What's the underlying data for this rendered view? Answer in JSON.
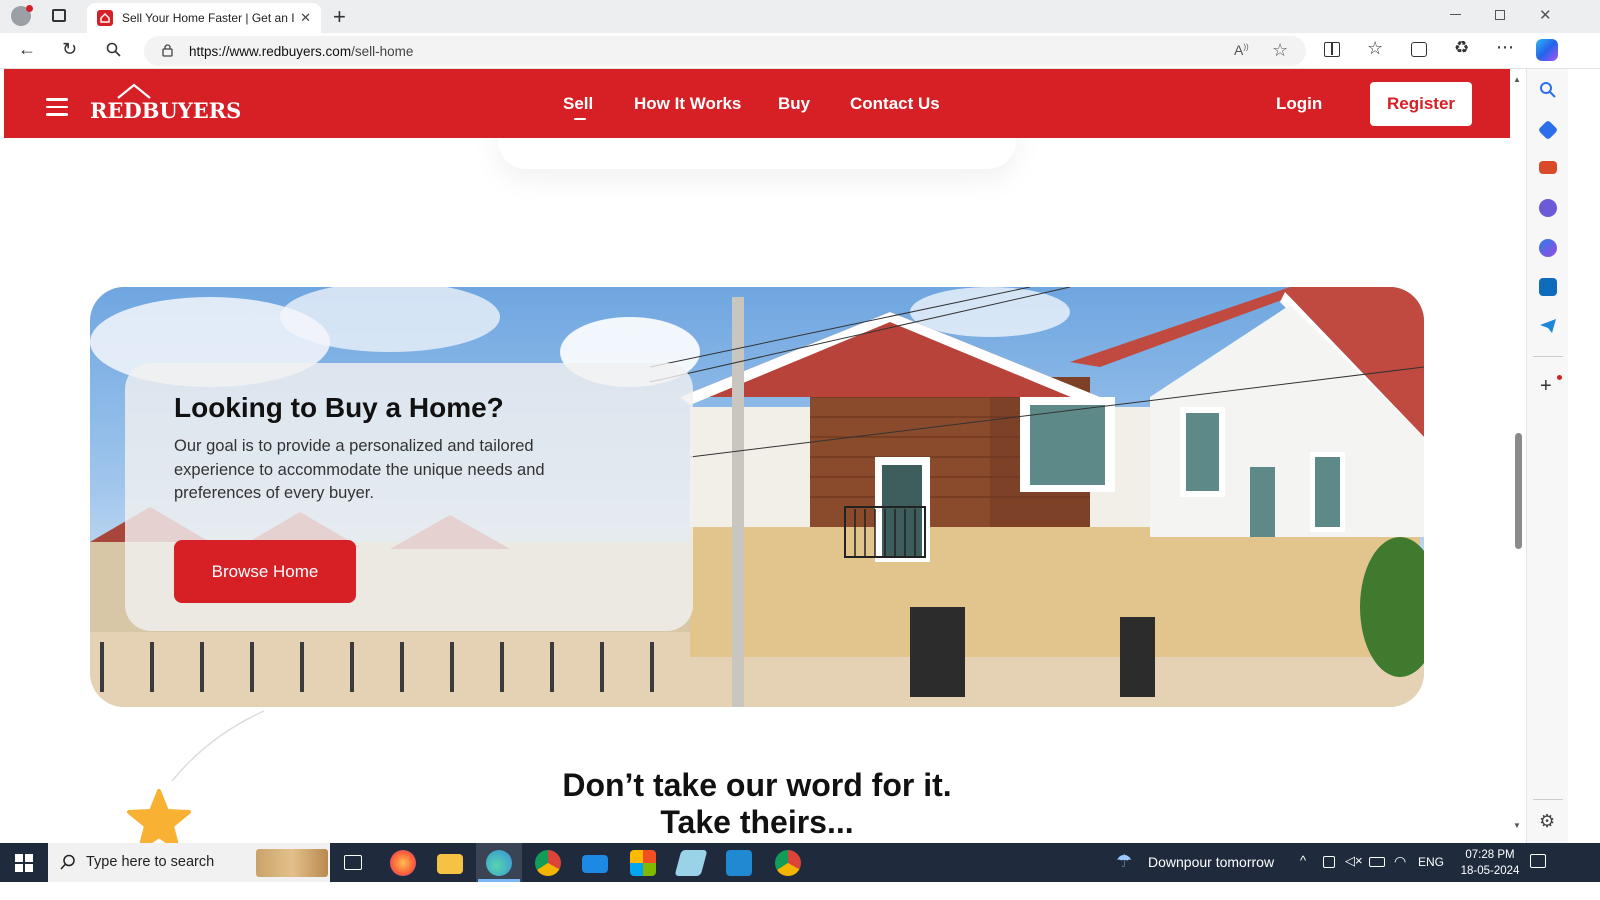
{
  "browser": {
    "tab_title": "Sell Your Home Faster | Get an In",
    "url_host": "https://www.redbuyers.com",
    "url_path": "/sell-home"
  },
  "site": {
    "logo_text": "REDBUYERS",
    "nav": {
      "sell": "Sell",
      "how_it_works": "How It Works",
      "buy": "Buy",
      "contact": "Contact Us",
      "login": "Login",
      "register": "Register"
    },
    "hero": {
      "title": "Looking to Buy a Home?",
      "description": "Our goal is to provide a personalized and tailored experience to accommodate the unique needs and preferences of every buyer.",
      "button": "Browse Home"
    },
    "testimonial_heading_1": "Don’t take our word for it.",
    "testimonial_heading_2": "Take theirs..."
  },
  "taskbar": {
    "search_placeholder": "Type here to search",
    "weather": "Downpour tomorrow",
    "language": "ENG",
    "time": "07:28 PM",
    "date": "18-05-2024"
  },
  "colors": {
    "brand_red": "#d71f26",
    "taskbar": "#1f2b3d"
  }
}
